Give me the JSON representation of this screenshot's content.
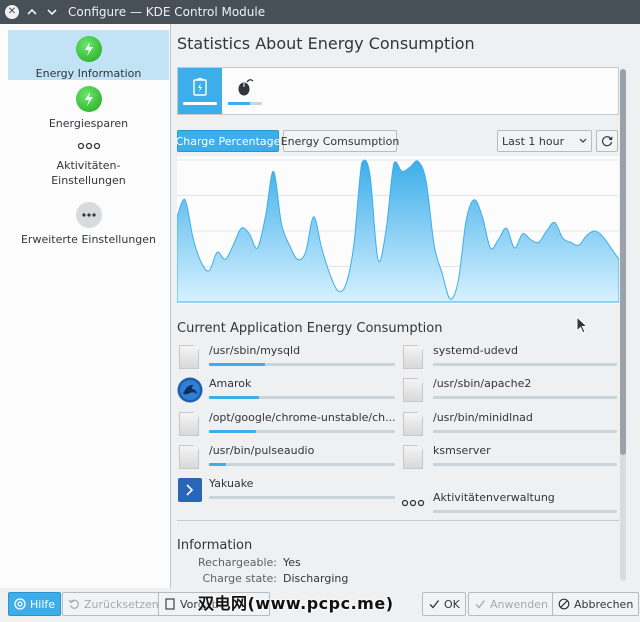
{
  "window": {
    "title": "Configure — KDE Control Module",
    "close_glyph": "✕",
    "pin_glyph": "⌃",
    "menu_glyph": "⌄"
  },
  "sidebar": {
    "items": [
      {
        "label": "Energy Information",
        "icon": "energy-icon",
        "active": true
      },
      {
        "label": "Energiesparen",
        "icon": "energy-icon",
        "active": false
      },
      {
        "label": "Aktivitäten-\nEinstellungen",
        "icon": "activities-icon",
        "active": false
      },
      {
        "label": "Erweiterte Einstellungen",
        "icon": "more-icon",
        "active": false
      }
    ]
  },
  "main": {
    "title": "Statistics About Energy Consumption",
    "tabs": [
      {
        "icon": "battery-icon",
        "selected": true,
        "level": 1.0
      },
      {
        "icon": "mouse-icon",
        "selected": false,
        "level": 0.65
      }
    ],
    "buttons": {
      "charge_percentage": "Charge Percentage",
      "energy_consumption": "Energy Comsumption",
      "time_range": "Last 1 hour",
      "refresh_icon": "refresh-icon"
    },
    "applications_title": "Current Application Energy Consumption",
    "applications": [
      {
        "name": "/usr/sbin/mysqld",
        "icon": "document-icon",
        "level": 0.3
      },
      {
        "name": "systemd-udevd",
        "icon": "document-icon",
        "level": 0.0
      },
      {
        "name": "Amarok",
        "icon": "amarok-icon",
        "level": 0.27
      },
      {
        "name": "/usr/sbin/apache2",
        "icon": "document-icon",
        "level": 0.0
      },
      {
        "name": "/opt/google/chrome-unstable/ch...",
        "icon": "document-icon",
        "level": 0.25
      },
      {
        "name": "/usr/bin/minidlnad",
        "icon": "document-icon",
        "level": 0.0
      },
      {
        "name": "/usr/bin/pulseaudio",
        "icon": "document-icon",
        "level": 0.09
      },
      {
        "name": "ksmserver",
        "icon": "document-icon",
        "level": 0.0
      },
      {
        "name": "Yakuake",
        "icon": "yakuake-icon",
        "level": 0.0
      },
      {
        "name": "Aktivitätenverwaltung",
        "icon": "activities-icon",
        "level": 0.0
      }
    ],
    "information": {
      "title": "Information",
      "rows": [
        {
          "key": "Rechargeable:",
          "value": "Yes"
        },
        {
          "key": "Charge state:",
          "value": "Discharging"
        }
      ]
    }
  },
  "bottom": {
    "help": "Hilfe",
    "reset": "Zurücksetzen",
    "defaults": "Vorgabe",
    "ok": "OK",
    "apply": "Anwenden",
    "cancel": "Abbrechen",
    "watermark": "双电网(www.pcpc.me)"
  },
  "colors": {
    "accent": "#3daee9",
    "titlebar": "#475057",
    "chart_fill_top": "#3daee9",
    "chart_fill_bottom": "#d7f1ff"
  },
  "chart_data": {
    "type": "area",
    "series": [
      {
        "values": [
          60,
          72,
          45,
          28,
          22,
          35,
          30,
          40,
          52,
          48,
          38,
          60,
          92,
          55,
          40,
          30,
          35,
          60,
          38,
          20,
          8,
          12,
          40,
          98,
          90,
          30,
          50,
          98,
          92,
          95,
          99,
          85,
          40,
          20,
          2,
          15,
          58,
          72,
          60,
          38,
          44,
          52,
          38,
          48,
          44,
          42,
          50,
          56,
          45,
          42,
          40,
          47,
          50,
          46,
          38,
          30
        ]
      }
    ],
    "ylim": [
      0,
      100
    ],
    "grid": true
  }
}
